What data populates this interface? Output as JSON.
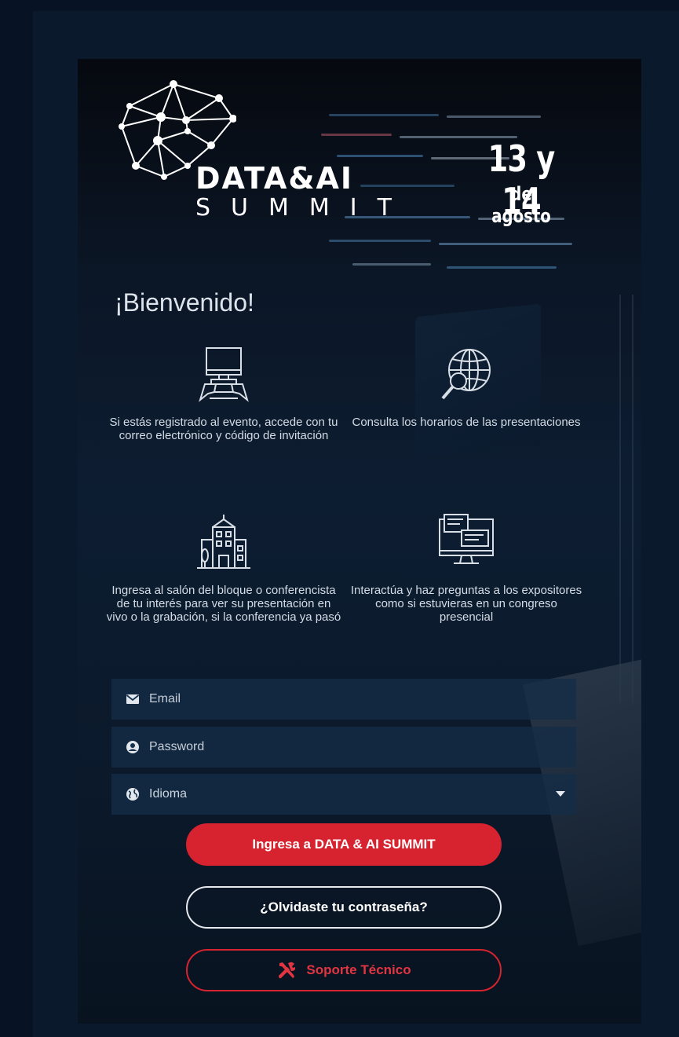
{
  "header": {
    "logo_title": "DATA&AI",
    "logo_subtitle": "SUMMIT",
    "date_days": "13 y 14",
    "date_month": "de agosto"
  },
  "welcome": "¡Bienvenido!",
  "features": [
    {
      "icon": "desk-computer-icon",
      "text": "Si estás registrado al evento, accede con tu correo electrónico y código de invitación"
    },
    {
      "icon": "globe-search-icon",
      "text": "Consulta los horarios de las presentaciones"
    },
    {
      "icon": "building-icon",
      "text": "Ingresa al salón del bloque o conferencista de tu interés para ver su presentación en vivo o la grabación, si la conferencia ya pasó"
    },
    {
      "icon": "monitor-chat-icon",
      "text": "Interactúa y haz preguntas a los expositores como si estuvieras en un congreso presencial"
    }
  ],
  "form": {
    "email_placeholder": "Email",
    "password_placeholder": "Password",
    "language_label": "Idioma"
  },
  "buttons": {
    "login": "Ingresa a DATA & AI SUMMIT",
    "forgot": "¿Olvidaste tu contraseña?",
    "support": "Soporte Técnico"
  },
  "colors": {
    "accent": "#d7232f",
    "background": "#071324",
    "field": "#142d46"
  }
}
